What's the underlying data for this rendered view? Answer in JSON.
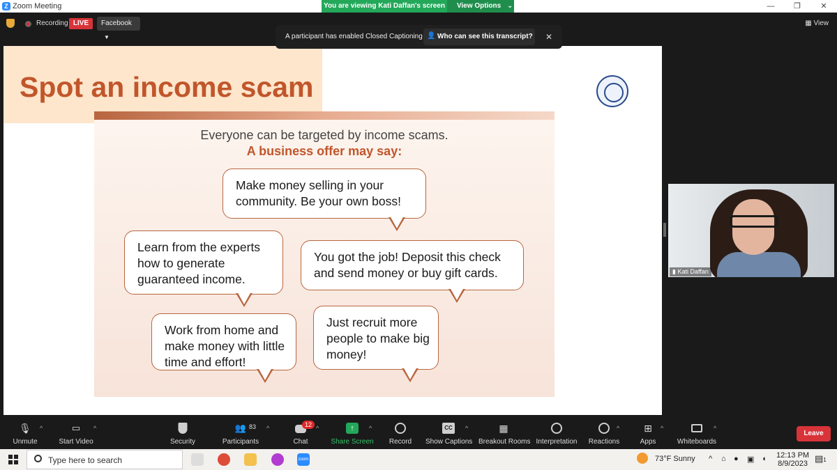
{
  "window": {
    "title": "Zoom Meeting",
    "viewing_text": "You are viewing Kati Daffan's screen",
    "view_options_label": "View Options",
    "controls": [
      "—",
      "❐",
      "✕"
    ]
  },
  "topbar": {
    "recording_label": "Recording",
    "live_label": "LIVE",
    "stream_target": "Facebook",
    "view_label": "View"
  },
  "caption_banner": {
    "message": "A participant has enabled Closed Captioning",
    "who_label": "Who can see this transcript?",
    "close": "✕"
  },
  "slide": {
    "title": "Spot an income scam",
    "intro": "Everyone can be targeted by income scams.",
    "subheading": "A business offer may say:",
    "bubbles": {
      "b1": "Make money selling in your community. Be your own boss!",
      "b2": "Learn from the experts how to generate guaranteed income.",
      "b3": "You got the job! Deposit this check and send money or buy gift cards.",
      "b4": "Work from home and make money with little time and effort!",
      "b5": "Just recruit more people to make big money!"
    },
    "colors": {
      "accent": "#c1562b",
      "peach": "#fde6cc"
    }
  },
  "video": {
    "participant_name": "Kati Daffan"
  },
  "controls": {
    "unmute": "Unmute",
    "start_video": "Start Video",
    "security": "Security",
    "participants": "Participants",
    "participants_count": "83",
    "chat": "Chat",
    "chat_badge": "12",
    "share_screen": "Share Screen",
    "record": "Record",
    "show_captions": "Show Captions",
    "cc_icon_text": "CC",
    "breakout_rooms": "Breakout Rooms",
    "interpretation": "Interpretation",
    "reactions": "Reactions",
    "apps": "Apps",
    "whiteboards": "Whiteboards",
    "leave": "Leave"
  },
  "taskbar": {
    "search_placeholder": "Type here to search",
    "weather": "73°F  Sunny",
    "time": "12:13 PM",
    "date": "8/9/2023",
    "zoom_icon_text": "zoom",
    "notification_count": "1"
  }
}
